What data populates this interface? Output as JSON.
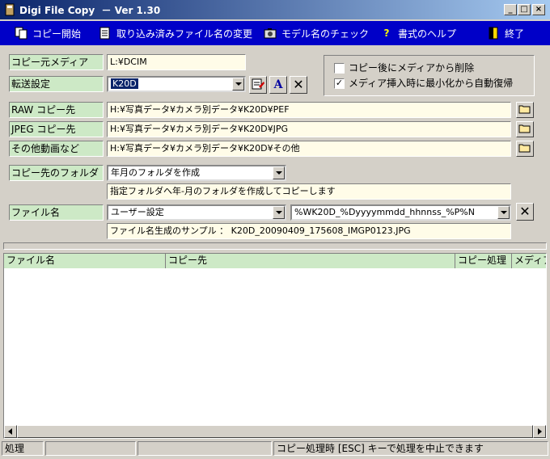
{
  "window": {
    "title": "Digi File Copy  － Ver 1.30"
  },
  "toolbar": {
    "items": [
      {
        "label": "コピー開始"
      },
      {
        "label": "取り込み済みファイル名の変更"
      },
      {
        "label": "モデル名のチェック"
      },
      {
        "label": "書式のヘルプ"
      },
      {
        "label": "終了"
      }
    ]
  },
  "form": {
    "source_media": {
      "label": "コピー元メディア",
      "value": "L:¥DCIM"
    },
    "transfer": {
      "label": "転送設定",
      "value": "K20D"
    },
    "raw": {
      "label": "RAW コピー先",
      "value": "H:¥写真データ¥カメラ別データ¥K20D¥PEF"
    },
    "jpeg": {
      "label": "JPEG コピー先",
      "value": "H:¥写真データ¥カメラ別データ¥K20D¥JPG"
    },
    "other": {
      "label": "その他動画など",
      "value": "H:¥写真データ¥カメラ別データ¥K20D¥その他"
    },
    "folder": {
      "label": "コピー先のフォルダ",
      "value": "年月のフォルダを作成",
      "description": "指定フォルダへ年-月のフォルダを作成してコピーします"
    },
    "filename": {
      "label": "ファイル名",
      "mode": "ユーザー設定",
      "pattern": "%WK20D_%Dyyyymmdd_hhnnss_%P%N",
      "sample": "ファイル名生成のサンプル ： K20D_20090409_175608_IMGP0123.JPG"
    }
  },
  "options": {
    "delete_after": {
      "label": "コピー後にメディアから削除",
      "checked": false
    },
    "auto_restore": {
      "label": "メディア挿入時に最小化から自動復帰",
      "checked": true
    }
  },
  "list": {
    "columns": [
      "ファイル名",
      "コピー先",
      "コピー処理",
      "メディア"
    ]
  },
  "status": {
    "state": "処理",
    "message": "コピー処理時 [ESC] キーで処理を中止できます"
  }
}
